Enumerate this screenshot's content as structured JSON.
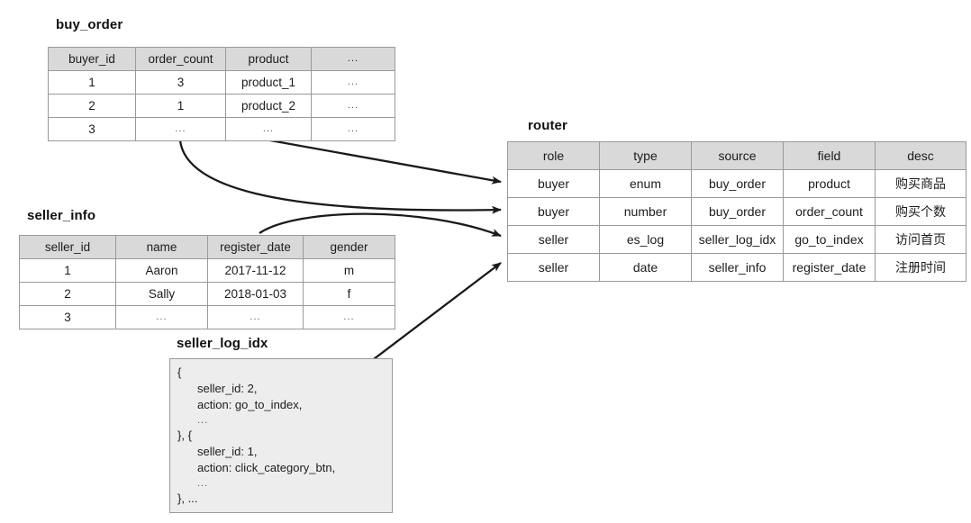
{
  "diagram": {
    "title_buy_order": "buy_order",
    "title_seller_info": "seller_info",
    "title_router": "router",
    "title_seller_log_idx": "seller_log_idx"
  },
  "buy_order": {
    "columns": [
      "buyer_id",
      "order_count",
      "product",
      "..."
    ],
    "rows": [
      [
        "1",
        "3",
        "product_1",
        "..."
      ],
      [
        "2",
        "1",
        "product_2",
        "..."
      ],
      [
        "3",
        "...",
        "...",
        "..."
      ]
    ]
  },
  "seller_info": {
    "columns": [
      "seller_id",
      "name",
      "register_date",
      "gender"
    ],
    "rows": [
      [
        "1",
        "Aaron",
        "2017-11-12",
        "m"
      ],
      [
        "2",
        "Sally",
        "2018-01-03",
        "f"
      ],
      [
        "3",
        "...",
        "...",
        "..."
      ]
    ]
  },
  "router": {
    "columns": [
      "role",
      "type",
      "source",
      "field",
      "desc"
    ],
    "rows": [
      [
        "buyer",
        "enum",
        "buy_order",
        "product",
        "购买商品"
      ],
      [
        "buyer",
        "number",
        "buy_order",
        "order_count",
        "购买个数"
      ],
      [
        "seller",
        "es_log",
        "seller_log_idx",
        "go_to_index",
        "访问首页"
      ],
      [
        "seller",
        "date",
        "seller_info",
        "register_date",
        "注册时间"
      ]
    ]
  },
  "seller_log_idx": {
    "lines": [
      "{",
      "seller_id: 2,",
      "action: go_to_index,",
      "...",
      "}, {",
      "seller_id: 1,",
      "action: click_category_btn,",
      "...",
      "}, ..."
    ]
  },
  "colors": {
    "header_fill": "#d9d9d9",
    "border": "#9a9a9a",
    "code_fill": "#ededed",
    "arrow": "#1a1a1a"
  }
}
